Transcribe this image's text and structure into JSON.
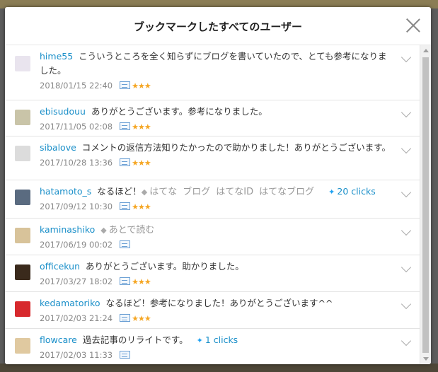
{
  "dialog": {
    "title": "ブックマークしたすべてのユーザー"
  },
  "bookmarks": [
    {
      "user": "hime55",
      "comment": "こういうところを全く知らずにブログを書いていたので、とても参考になりました。",
      "date": "2018/01/15 22:40",
      "stars": "★★★",
      "avatar_color": "#e9e4ee"
    },
    {
      "user": "ebisudouu",
      "comment": "ありがとうございます。参考になりました。",
      "date": "2017/11/05 02:08",
      "stars": "★★★",
      "avatar_color": "#c9c4a8"
    },
    {
      "user": "sibalove",
      "comment": "コメントの返信方法知りたかったので助かりました！ありがとうございます。",
      "date": "2017/10/28 13:36",
      "stars": "★★★",
      "avatar_color": "#dcdcdc"
    },
    {
      "user": "hatamoto_s",
      "comment": "なるほど！",
      "tags": [
        "はてな",
        "ブログ",
        "はてなID",
        "はてなブログ"
      ],
      "clicks": "20 clicks",
      "date": "2017/09/12 10:30",
      "stars": "★★★",
      "avatar_color": "#5a6b80"
    },
    {
      "user": "kaminashiko",
      "comment": "",
      "tags": [
        "あとで読む"
      ],
      "date": "2017/06/19 00:02",
      "stars": "",
      "avatar_color": "#d8c39a"
    },
    {
      "user": "officekun",
      "comment": "ありがとうございます。助かりました。",
      "date": "2017/03/27 18:02",
      "stars": "★★★",
      "avatar_color": "#3a2a1c"
    },
    {
      "user": "kedamatoriko",
      "comment": "なるほど！参考になりました！ありがとうございます^^",
      "date": "2017/02/03 21:24",
      "stars": "★★★",
      "avatar_color": "#d7292d"
    },
    {
      "user": "flowcare",
      "comment": "過去記事のリライトです。",
      "clicks": "1 clicks",
      "date": "2017/02/03 11:33",
      "stars": "",
      "avatar_color": "#e0c9a0"
    }
  ],
  "icons": {
    "tag": "tag-icon",
    "twitter": "twitter-bird-icon",
    "entry": "entry-icon",
    "expand": "chevron-down-icon",
    "close": "close-icon"
  }
}
